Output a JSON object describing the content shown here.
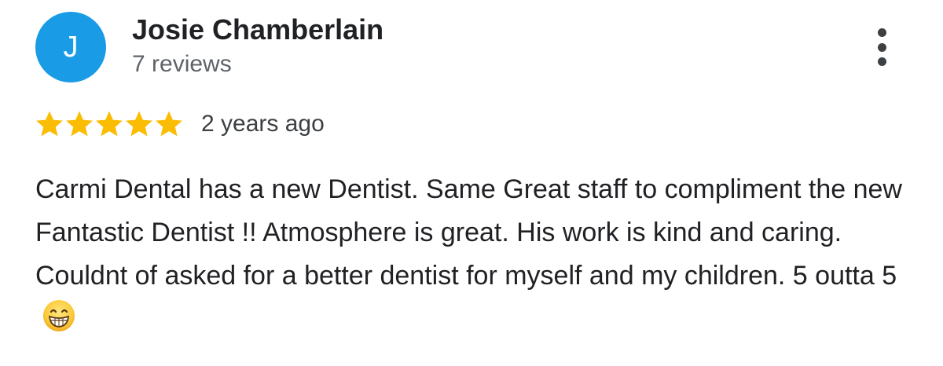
{
  "review": {
    "author_initial": "J",
    "author_name": "Josie Chamberlain",
    "author_reviews": "7 reviews",
    "rating": 5,
    "rating_max": 5,
    "time_ago": "2 years ago",
    "text": "Carmi Dental has a new Dentist. Same Great staff to compliment the new Fantastic Dentist !! Atmosphere is great. His work is kind and caring. Couldnt of asked for a better dentist for myself and my children. 5 outta 5",
    "trailing_emoji": "grinning-face-with-smiling-eyes-icon"
  },
  "colors": {
    "avatar_bg": "#1a9be6",
    "star": "#fbbc04",
    "name_text": "#202124",
    "secondary_text": "#5f6368"
  },
  "icons": {
    "menu": "more-vertical-icon",
    "star": "star-icon"
  }
}
